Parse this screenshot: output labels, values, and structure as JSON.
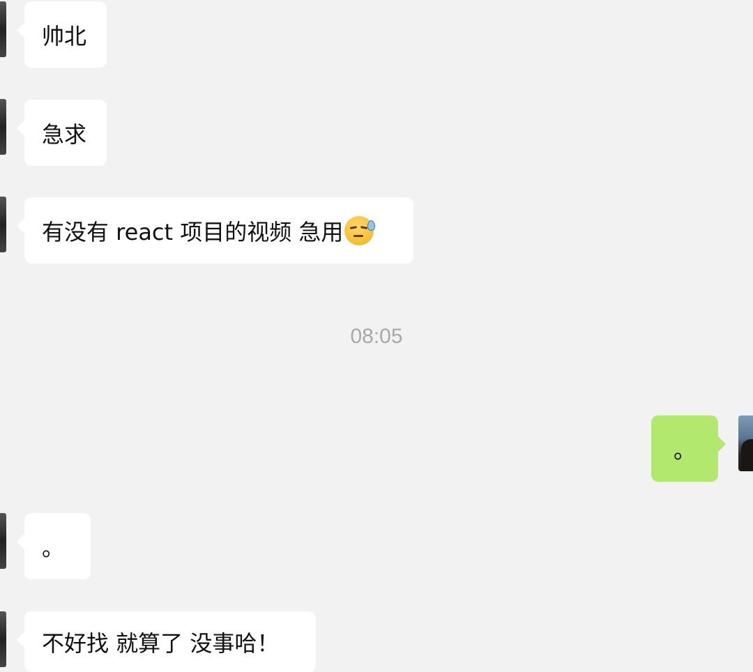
{
  "messages": [
    {
      "side": "in",
      "text": "帅北"
    },
    {
      "side": "in",
      "text": "急求"
    },
    {
      "side": "in",
      "text": "有没有 react 项目的视频 急用",
      "emoji": "sweat-smile-emoji"
    },
    {
      "side": "out",
      "text": "。"
    },
    {
      "side": "in",
      "text": "。"
    },
    {
      "side": "in",
      "text": "不好找 就算了 没事哈！"
    }
  ],
  "timestamp": "08:05",
  "colors": {
    "background": "#f2f2f2",
    "incoming_bubble": "#ffffff",
    "outgoing_bubble": "#b3e86f",
    "timestamp_text": "#a8a8a8"
  }
}
